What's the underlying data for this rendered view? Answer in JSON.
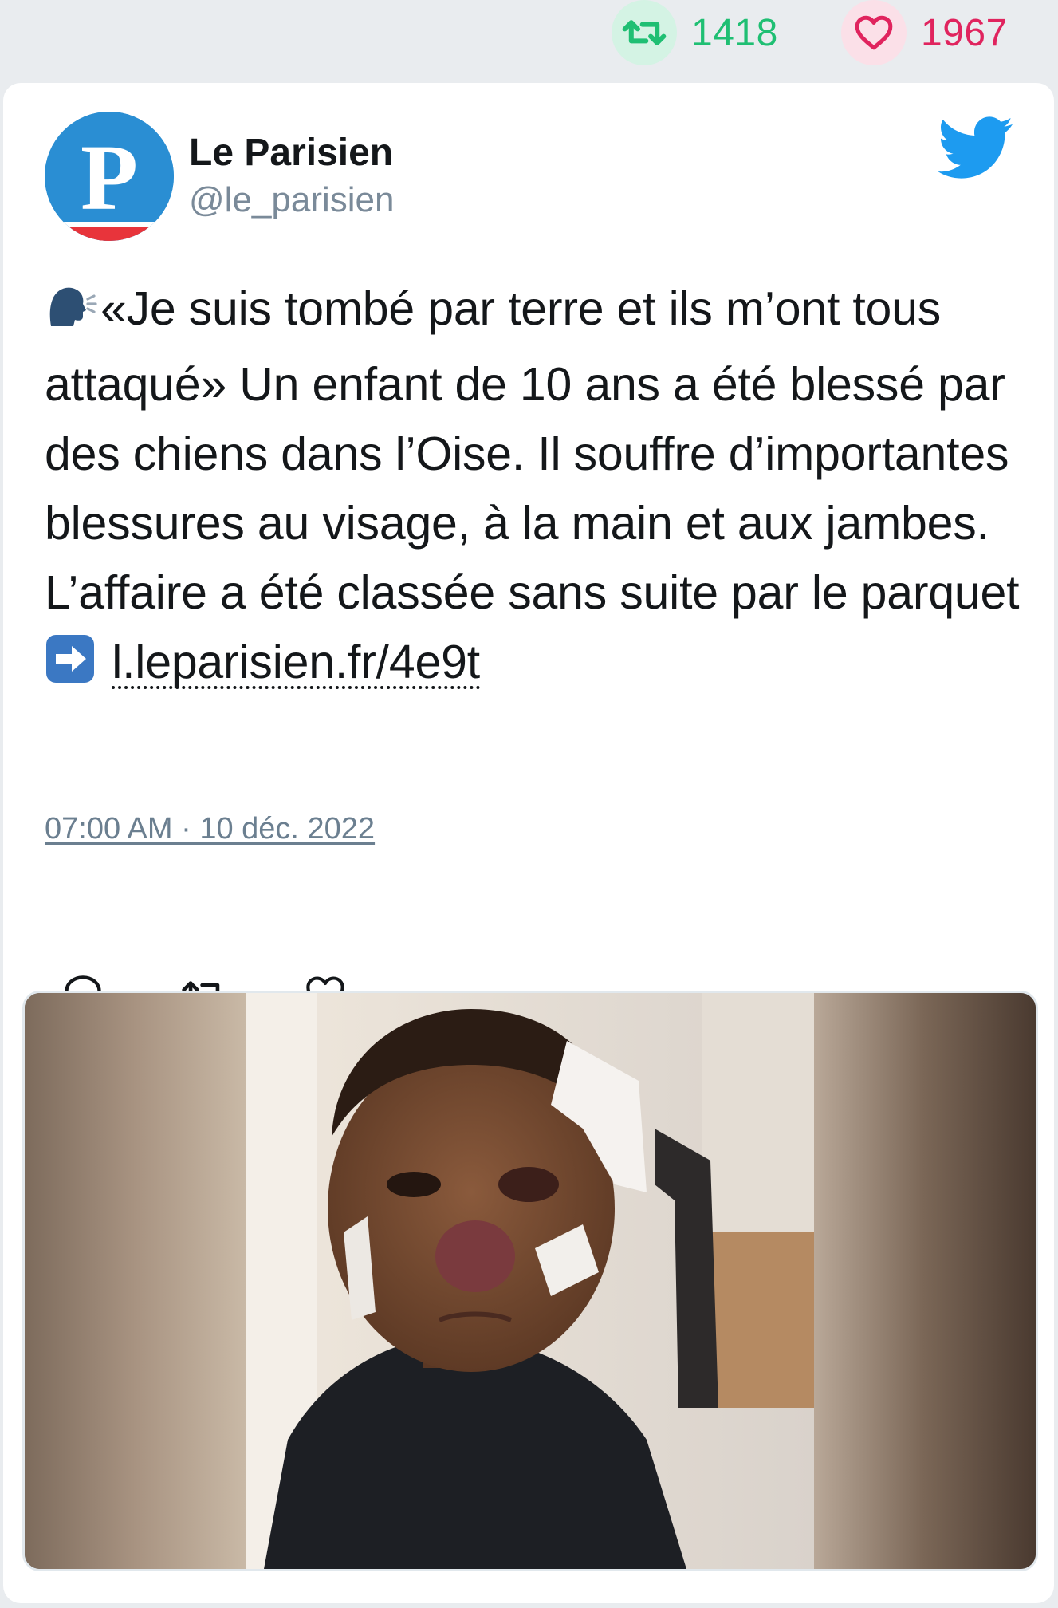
{
  "stats": {
    "retweets": "1418",
    "likes": "1967",
    "retweet_icon": "retweet-icon",
    "like_icon": "heart-icon",
    "retweet_color": "#1fbf73",
    "like_color": "#e0245e"
  },
  "user": {
    "name": "Le Parisien",
    "handle": "@le_parisien",
    "avatar_letter": "P",
    "avatar_color": "#2a8ed3"
  },
  "tweet": {
    "text_main": "«Je suis tombé par terre et ils m’ont tous attaqué» Un enfant de 10 ans a été blessé par des chiens dans l’Oise. Il souffre d’importantes blessures au visage, à la main et aux jambes. L’affaire a été classée sans suite par le parquet",
    "leading_emoji": "speaking-head-emoji",
    "arrow_emoji": "right-arrow-emoji",
    "link": "l.leparisien.fr/4e9t",
    "timestamp": "07:00 AM · 10 déc. 2022"
  },
  "actions": [
    "reply-icon",
    "retweet-icon",
    "like-icon"
  ],
  "brand": {
    "twitter_blue": "#1d9bf0"
  }
}
